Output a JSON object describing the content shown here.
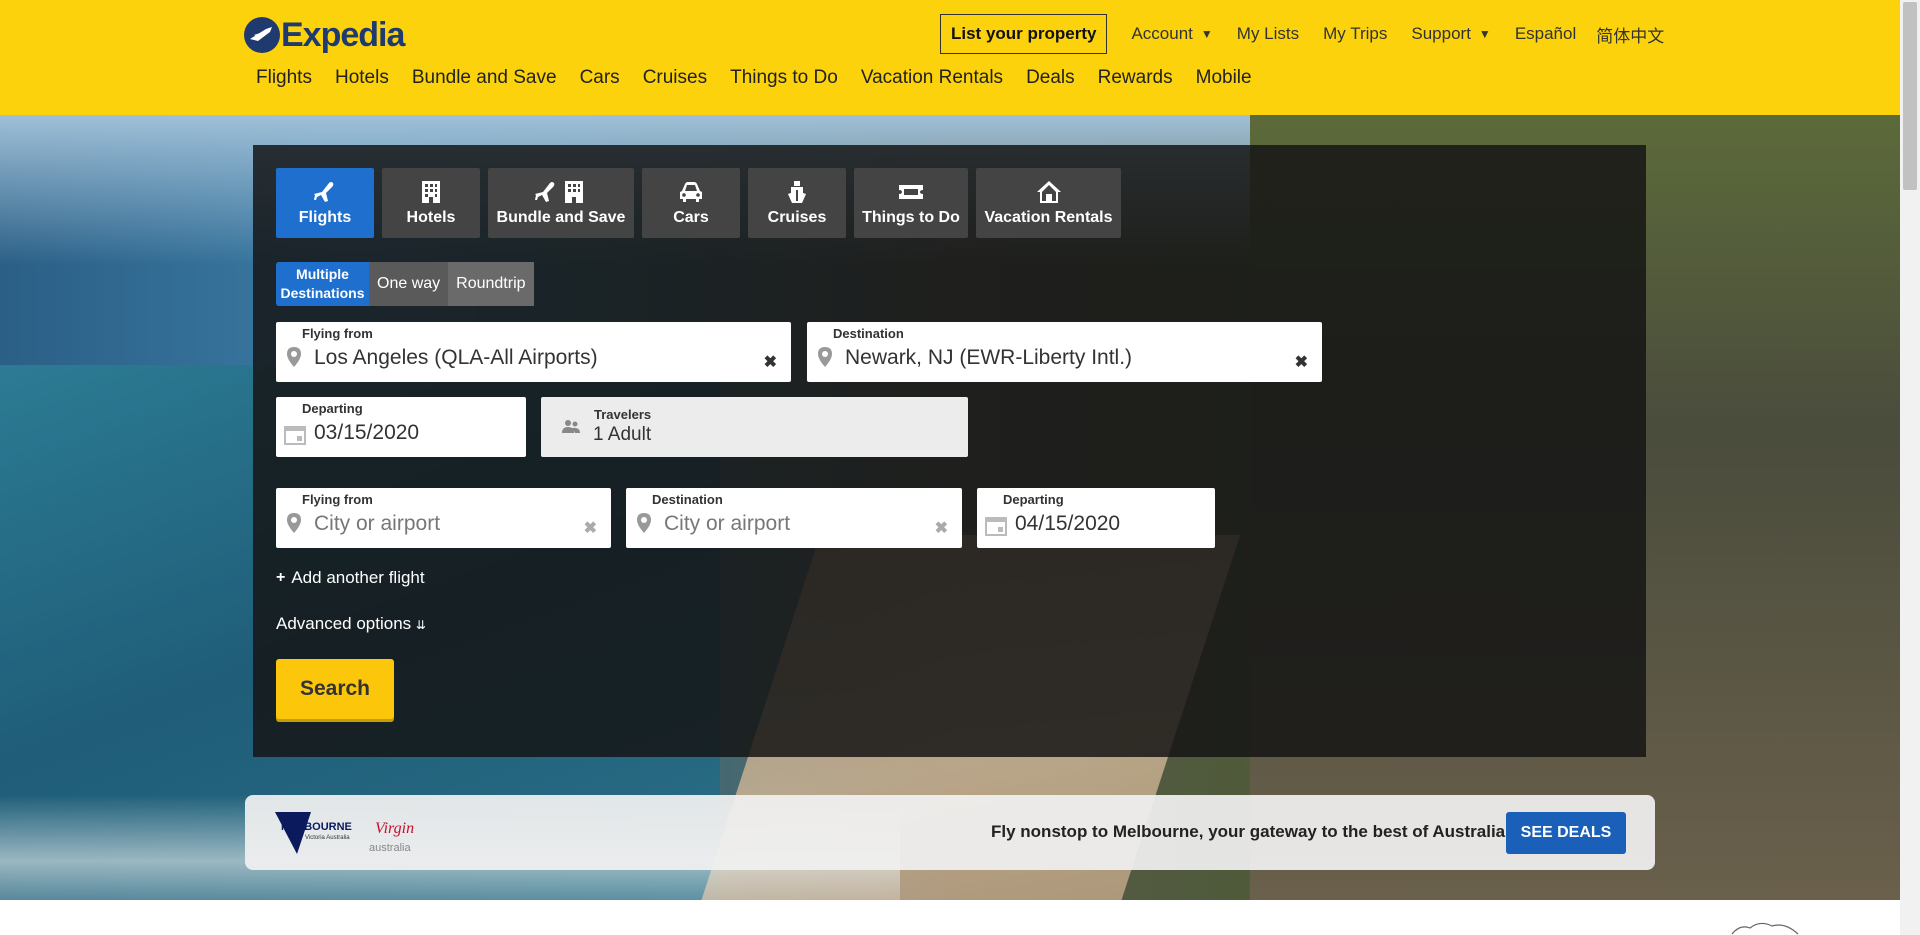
{
  "header": {
    "logo_text": "Expedia",
    "list_property": "List your property",
    "util_links": [
      {
        "label": "Account",
        "dropdown": true
      },
      {
        "label": "My Lists",
        "dropdown": false
      },
      {
        "label": "My Trips",
        "dropdown": false
      },
      {
        "label": "Support",
        "dropdown": true
      },
      {
        "label": "Español",
        "dropdown": false
      },
      {
        "label": "简体中文",
        "dropdown": false
      }
    ],
    "main_nav": [
      "Flights",
      "Hotels",
      "Bundle and Save",
      "Cars",
      "Cruises",
      "Things to Do",
      "Vacation Rentals",
      "Deals",
      "Rewards",
      "Mobile"
    ]
  },
  "search": {
    "tabs": [
      {
        "label": "Flights",
        "icon": "plane-icon",
        "active": true
      },
      {
        "label": "Hotels",
        "icon": "building-icon",
        "active": false
      },
      {
        "label": "Bundle and Save",
        "icon": "plane-building-icon",
        "active": false
      },
      {
        "label": "Cars",
        "icon": "car-icon",
        "active": false
      },
      {
        "label": "Cruises",
        "icon": "ship-icon",
        "active": false
      },
      {
        "label": "Things to Do",
        "icon": "ticket-icon",
        "active": false
      },
      {
        "label": "Vacation Rentals",
        "icon": "house-icon",
        "active": false
      }
    ],
    "trip_types": {
      "multi": "Multiple Destinations",
      "oneway": "One way",
      "roundtrip": "Roundtrip"
    },
    "flight1": {
      "from_label": "Flying from",
      "from_value": "Los Angeles (QLA-All Airports)",
      "dest_label": "Destination",
      "dest_value": "Newark, NJ (EWR-Liberty Intl.)",
      "depart_label": "Departing",
      "depart_value": "03/15/2020"
    },
    "travelers": {
      "label": "Travelers",
      "value": "1 Adult"
    },
    "flight2": {
      "from_label": "Flying from",
      "from_placeholder": "City or airport",
      "dest_label": "Destination",
      "dest_placeholder": "City or airport",
      "depart_label": "Departing",
      "depart_value": "04/15/2020"
    },
    "add_flight": "Add another flight",
    "advanced": "Advanced options",
    "search_button": "Search"
  },
  "promo": {
    "melbourne_logo": "MELBOURNE",
    "melbourne_sub": "Victoria Australia",
    "virgin_logo": "Virgin",
    "virgin_sub": "australia",
    "text": "Fly nonstop to Melbourne, your gateway to the best of Australia",
    "button": "SEE DEALS"
  },
  "colors": {
    "header_bg": "#fcd20c",
    "active_tab": "#1f6fcf",
    "search_button": "#fcc60a",
    "deals_button": "#1a5fb8"
  }
}
